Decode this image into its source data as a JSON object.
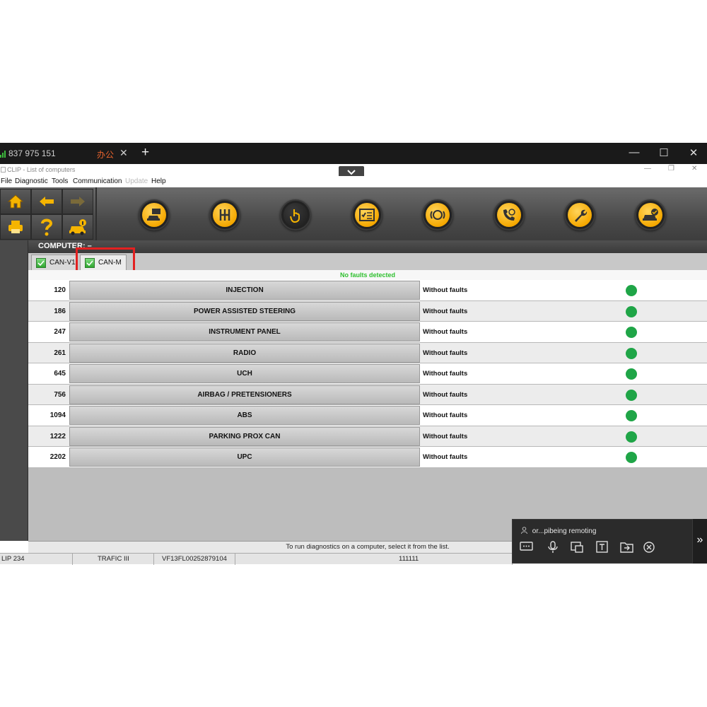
{
  "remote_bar": {
    "connection_id": "837 975 151",
    "tab_label": "办公",
    "close_glyph": "✕",
    "new_tab_glyph": "+",
    "minimize_glyph": "—",
    "maximize_glyph": "☐",
    "close_window_glyph": "✕"
  },
  "window": {
    "title": "CLIP - List of computers",
    "min_glyph": "—",
    "restore_glyph": "❐",
    "close_glyph": "✕"
  },
  "menu": {
    "items": [
      "File",
      "Diagnostic",
      "Tools",
      "Communication",
      "Update",
      "Help"
    ]
  },
  "toolbar": {
    "left_buttons": [
      "home-icon",
      "back-arrow-icon",
      "forward-arrow-icon",
      "printer-icon",
      "help-icon",
      "vehicle-info-icon"
    ],
    "function_buttons": [
      "vehicle-identification-icon",
      "gearbox-icon",
      "touch-hand-icon",
      "checklist-card-icon",
      "brake-icon",
      "phone-car-icon",
      "wrench-icon",
      "vehicle-check-icon"
    ]
  },
  "computer_header": {
    "label": "COMPUTER:",
    "value": "–"
  },
  "tabs": [
    {
      "label": "CAN-V1",
      "checked": true
    },
    {
      "label": "CAN-M",
      "checked": true,
      "selected": true
    }
  ],
  "status_message": "No faults detected",
  "ecus": [
    {
      "number": "120",
      "name": "INJECTION",
      "status": "Without faults"
    },
    {
      "number": "186",
      "name": "POWER ASSISTED STEERING",
      "status": "Without faults"
    },
    {
      "number": "247",
      "name": "INSTRUMENT PANEL",
      "status": "Without faults"
    },
    {
      "number": "261",
      "name": "RADIO",
      "status": "Without faults"
    },
    {
      "number": "645",
      "name": "UCH",
      "status": "Without faults"
    },
    {
      "number": "756",
      "name": "AIRBAG / PRETENSIONERS",
      "status": "Without faults"
    },
    {
      "number": "1094",
      "name": "ABS",
      "status": "Without faults"
    },
    {
      "number": "1222",
      "name": "PARKING PROX CAN",
      "status": "Without faults"
    },
    {
      "number": "2202",
      "name": "UPC",
      "status": "Without faults"
    }
  ],
  "hint": "To run diagnostics on a computer, select it from the list.",
  "statusbar": {
    "tool": "LIP 234",
    "vehicle": "TRAFIC III",
    "vin": "VF13FL00252879104",
    "code": "111111"
  },
  "remote_panel": {
    "title": "or...pibeing remoting",
    "icons": [
      "chat-icon",
      "microphone-icon",
      "screen-share-icon",
      "text-icon",
      "folder-transfer-icon",
      "close-circle-icon"
    ],
    "expand_glyph": "»"
  },
  "colors": {
    "ok_green": "#1fa547",
    "highlight_red": "#e32020",
    "accent_yellow": "#f5a800"
  }
}
